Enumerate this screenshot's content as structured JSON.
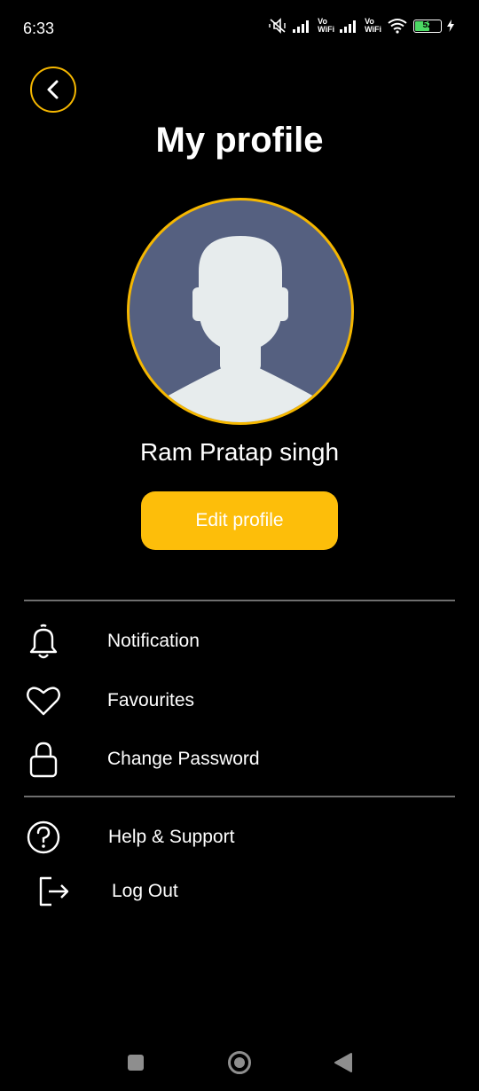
{
  "status_bar": {
    "time": "6:33",
    "network_label_1": [
      "Vo",
      "WiFi"
    ],
    "network_label_2": [
      "Vo",
      "WiFi"
    ],
    "battery_level": "52",
    "icons": [
      "mute-icon",
      "signal-icon",
      "signal-icon",
      "wifi-icon",
      "battery-icon",
      "charging-icon"
    ]
  },
  "header": {
    "back_icon": "chevron-left-icon",
    "title": "My profile"
  },
  "profile": {
    "avatar_icon": "person-silhouette",
    "name": "Ram Pratap singh",
    "edit_label": "Edit profile"
  },
  "menu": {
    "items": [
      {
        "icon": "bell-icon",
        "label": "Notification"
      },
      {
        "icon": "heart-icon",
        "label": "Favourites"
      },
      {
        "icon": "lock-icon",
        "label": "Change Password"
      },
      {
        "icon": "help-icon",
        "label": "Help & Support"
      },
      {
        "icon": "logout-icon",
        "label": "Log Out"
      }
    ]
  },
  "nav_bar": {
    "icons": [
      "recents-icon",
      "home-icon",
      "back-icon"
    ]
  },
  "colors": {
    "background": "#000000",
    "accent": "#F5B700",
    "button": "#FDBE0A",
    "avatar_bg": "#556080",
    "avatar_figure": "#E7ECED",
    "text": "#FFFFFF",
    "divider": "#6E6E6E"
  }
}
